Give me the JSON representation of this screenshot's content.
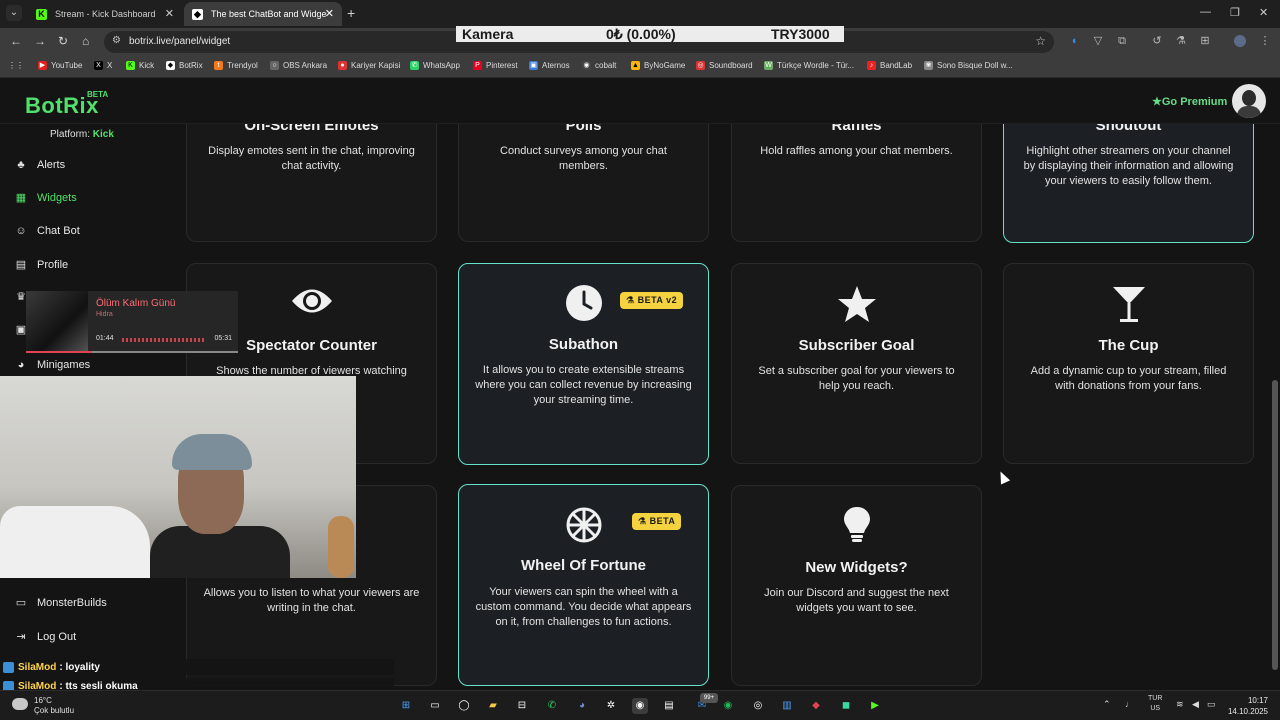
{
  "browser": {
    "tabs": [
      {
        "title": "Stream - Kick Dashboard",
        "active": false
      },
      {
        "title": "The best ChatBot and Widgets",
        "active": true
      }
    ],
    "url": "botrix.live/panel/widget",
    "bookmarks": [
      "YouTube",
      "X",
      "Kick",
      "BotRix",
      "Trendyol",
      "OBS Ankara",
      "Kariyer Kapisi",
      "WhatsApp",
      "Pinterest",
      "Aternos",
      "cobalt",
      "ByNoGame",
      "Soundboard",
      "Türkçe Wordle - Tür...",
      "BandLab",
      "Sono Bisque Doll w..."
    ]
  },
  "ticker": {
    "label": "Kamera",
    "change": "0₺ (0.00%)",
    "value": "TRY3000"
  },
  "app": {
    "logo": "BotRix",
    "logo_badge": "BETA",
    "premium": "Go Premium",
    "platform_label": "Platform:",
    "platform_value": "Kick"
  },
  "sidebar": {
    "items": [
      {
        "label": "Alerts",
        "icon": "bell-icon",
        "active": false
      },
      {
        "label": "Widgets",
        "icon": "grid-icon",
        "active": true
      },
      {
        "label": "Chat Bot",
        "icon": "robot-icon",
        "active": false
      },
      {
        "label": "Profile",
        "icon": "id-card-icon",
        "active": false
      },
      {
        "label": "Minigames",
        "icon": "gamepad-icon",
        "active": false
      },
      {
        "label": "MonsterBuilds",
        "icon": "laptop-icon",
        "active": false
      },
      {
        "label": "Log Out",
        "icon": "logout-icon",
        "active": false
      }
    ]
  },
  "widgets": {
    "row1": [
      {
        "title": "On-Screen Emotes",
        "desc": "Display emotes sent in the chat, improving chat activity."
      },
      {
        "title": "Polls",
        "desc": "Conduct surveys among your chat members."
      },
      {
        "title": "Raffles",
        "desc": "Hold raffles among your chat members."
      },
      {
        "title": "Shoutout",
        "desc": "Highlight other streamers on your channel by displaying their information and allowing your viewers to easily follow them."
      }
    ],
    "row2": [
      {
        "title": "Spectator Counter",
        "desc": "Shows the number of viewers watching",
        "icon": "eye-icon"
      },
      {
        "title": "Subathon",
        "desc": "It allows you to create extensible streams where you can collect revenue by increasing your streaming time.",
        "icon": "clock-icon",
        "badge": "BETA v2"
      },
      {
        "title": "Subscriber Goal",
        "desc": "Set a subscriber goal for your viewers to help you reach.",
        "icon": "star-icon"
      },
      {
        "title": "The Cup",
        "desc": "Add a dynamic cup to your stream, filled with donations from your fans.",
        "icon": "cocktail-icon"
      }
    ],
    "row3": [
      {
        "title": "",
        "desc": "Allows you to listen to what your viewers are writing in the chat."
      },
      {
        "title": "Wheel Of Fortune",
        "desc": "Your viewers can spin the wheel with a custom command. You decide what appears on it, from challenges to fun actions.",
        "icon": "wheel-icon",
        "badge": "BETA"
      },
      {
        "title": "New Widgets?",
        "desc": "Join our Discord and suggest the next widgets you want to see.",
        "icon": "lightbulb-icon"
      }
    ]
  },
  "music_overlay": {
    "song": "Ölüm Kalım Günü",
    "artist": "Hidra",
    "elapsed": "01:44",
    "total": "05:31",
    "progress": 0.31
  },
  "chat_overlay": [
    {
      "user": "SilaMod",
      "message": ": loyality"
    },
    {
      "user": "SilaMod",
      "message": ": tts sesli okuma"
    }
  ],
  "taskbar": {
    "temperature": "16°C",
    "weather": "Çok bulutlu",
    "language": "TUR",
    "region": "US",
    "time": "10:17",
    "date": "14.10.2025",
    "notif_badge": "99+"
  },
  "colors": {
    "accent": "#52e06c",
    "highlight_border": "#62e3c7",
    "beta_badge": "#f5d33f",
    "chat_user": "#ffd34d"
  }
}
